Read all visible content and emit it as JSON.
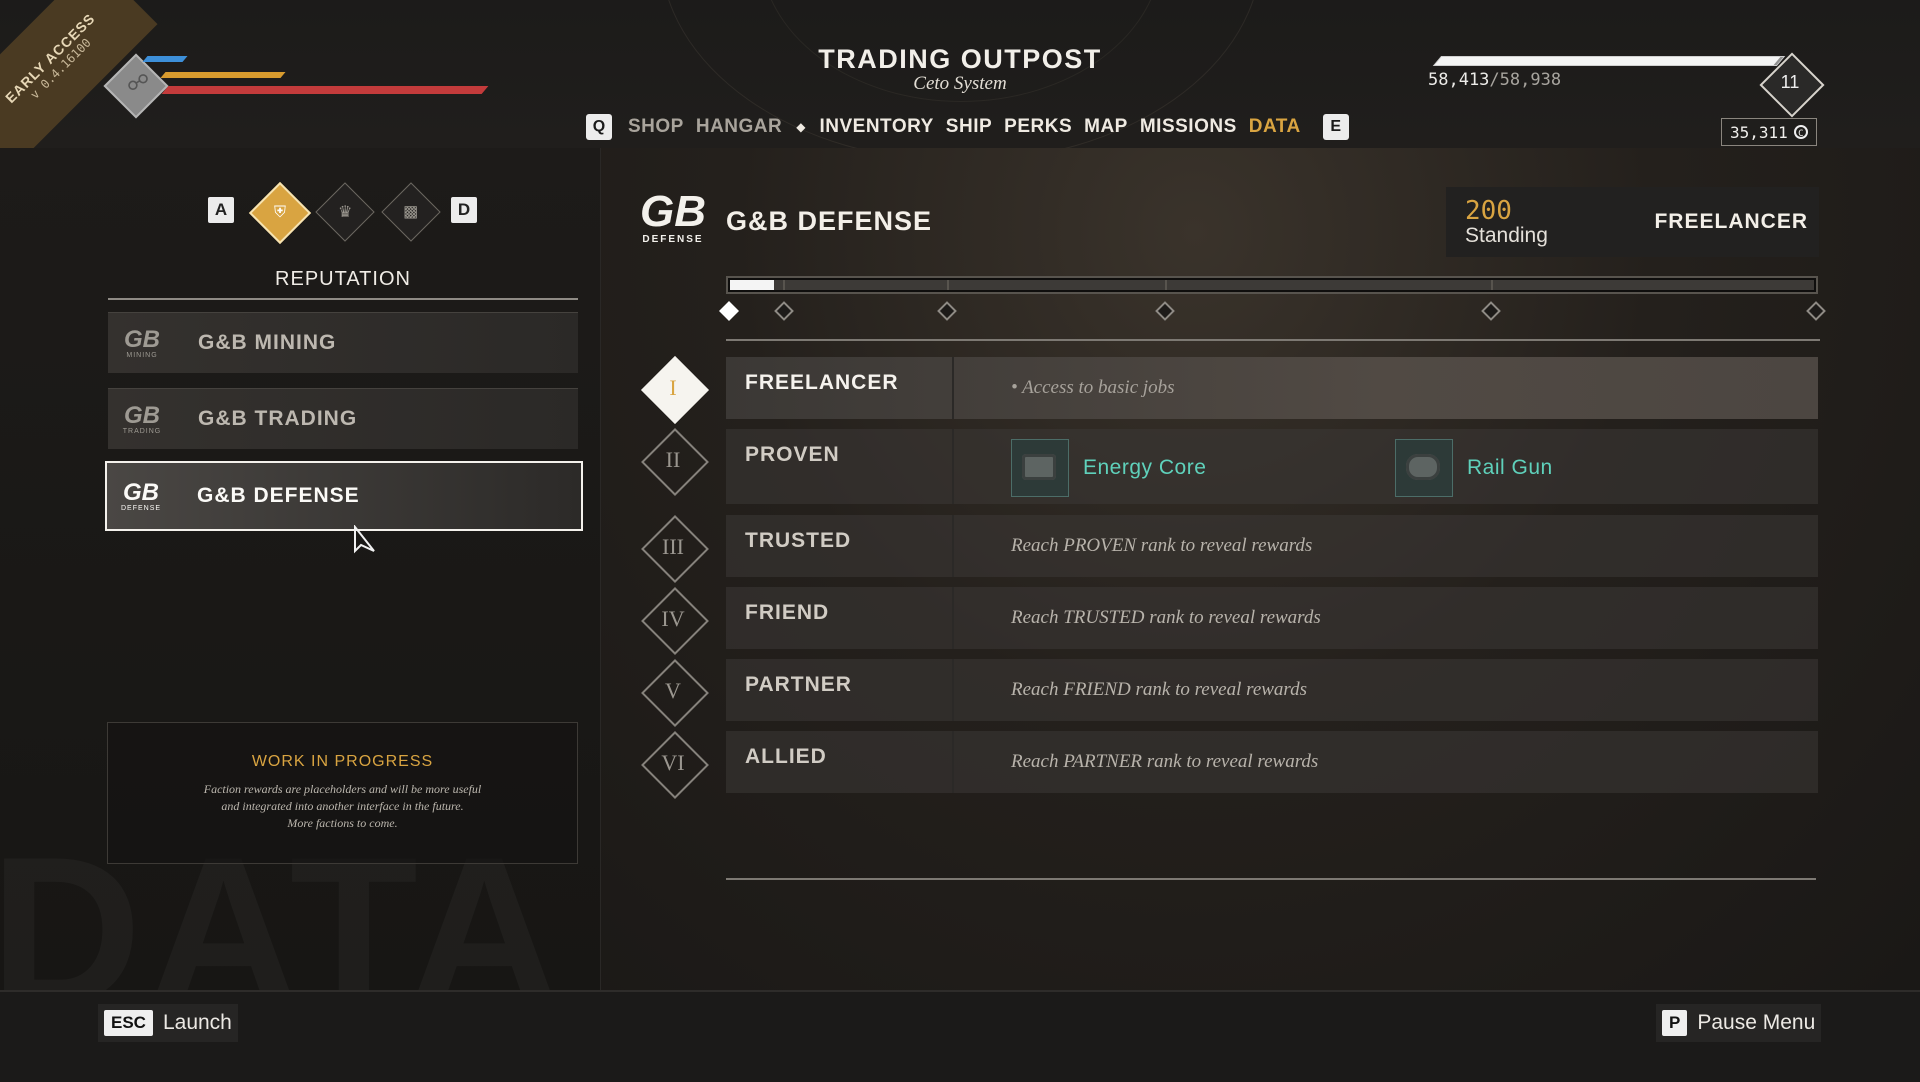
{
  "badge": {
    "line1": "EARLY ACCESS",
    "line2": "v 0.4.16100"
  },
  "header": {
    "title": "TRADING OUTPOST",
    "subtitle": "Ceto System",
    "nav": {
      "prev_key": "Q",
      "next_key": "E",
      "items": [
        "SHOP",
        "HANGAR",
        "INVENTORY",
        "SHIP",
        "PERKS",
        "MAP",
        "MISSIONS",
        "DATA"
      ],
      "active": "DATA"
    }
  },
  "player": {
    "xp_current": "58,413",
    "xp_max": "/58,938",
    "xp_progress": 0.991,
    "level": "11",
    "credits": "35,311",
    "credit_icon": "credit-coin-icon",
    "shield": 0.2,
    "energy": 0.4,
    "hull": 1.0
  },
  "left": {
    "tab_prev_key": "A",
    "tab_next_key": "D",
    "tabs": [
      {
        "icon": "shield-badge-icon",
        "active": true
      },
      {
        "icon": "crown-icon",
        "active": false
      },
      {
        "icon": "bar-chart-icon",
        "active": false
      }
    ],
    "section_title": "REPUTATION",
    "factions": [
      {
        "logo": "GB",
        "logo_sub": "MINING",
        "name": "G&B MINING"
      },
      {
        "logo": "GB",
        "logo_sub": "TRADING",
        "name": "G&B TRADING"
      },
      {
        "logo": "GB",
        "logo_sub": "DEFENSE",
        "name": "G&B DEFENSE"
      }
    ],
    "wip": {
      "title": "WORK IN PROGRESS",
      "body": "Faction rewards are placeholders and will be more useful\nand integrated into another interface in the future.\nMore factions to come."
    },
    "watermark": "DATA"
  },
  "detail": {
    "logo": "GB",
    "logo_sub": "DEFENSE",
    "title": "G&B DEFENSE",
    "standing_value": "200",
    "standing_label": "Standing",
    "current_rank": "FREELANCER",
    "progress_fraction": 0.04,
    "ranks": [
      {
        "numeral": "I",
        "name": "FREELANCER",
        "desc": "Access to basic jobs",
        "active": true
      },
      {
        "numeral": "II",
        "name": "PROVEN",
        "rewards": [
          {
            "name": "Energy Core",
            "icon": "energy-core-icon"
          },
          {
            "name": "Rail Gun",
            "icon": "rail-gun-icon"
          }
        ]
      },
      {
        "numeral": "III",
        "name": "TRUSTED",
        "desc": "Reach PROVEN rank to reveal rewards"
      },
      {
        "numeral": "IV",
        "name": "FRIEND",
        "desc": "Reach TRUSTED rank to reveal rewards"
      },
      {
        "numeral": "V",
        "name": "PARTNER",
        "desc": "Reach FRIEND rank to reveal rewards"
      },
      {
        "numeral": "VI",
        "name": "ALLIED",
        "desc": "Reach PARTNER rank to reveal rewards"
      }
    ]
  },
  "footer": {
    "left_key": "ESC",
    "left_label": "Launch",
    "right_key": "P",
    "right_label": "Pause Menu"
  }
}
